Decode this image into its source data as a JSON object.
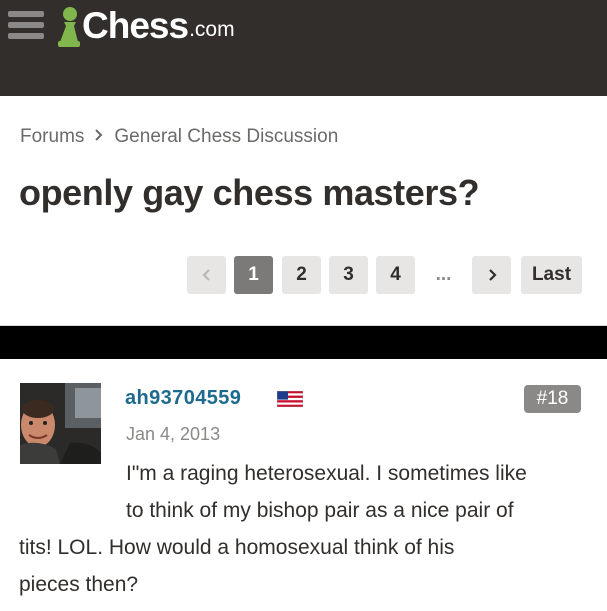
{
  "site": {
    "logo_text": "Chess",
    "logo_suffix": ".com",
    "colors": {
      "topbar": "#312e2b",
      "brand_green": "#81b64c",
      "link_blue": "#1d6a8e"
    }
  },
  "breadcrumb": {
    "items": [
      "Forums",
      "General Chess Discussion"
    ],
    "separator_icon": "chevron-right-icon"
  },
  "thread": {
    "title": "openly gay chess masters?"
  },
  "pagination": {
    "prev_icon": "chevron-left-icon",
    "pages": [
      "1",
      "2",
      "3",
      "4"
    ],
    "current_page": "1",
    "ellipsis": "...",
    "next_icon": "chevron-right-icon",
    "last_label": "Last"
  },
  "post": {
    "username": "ah93704559",
    "country_flag": "us-flag-icon",
    "date": "Jan 4, 2013",
    "number": "#18",
    "body_lines": [
      "I\"m a raging heterosexual. I sometimes like",
      "to think of my bishop pair as a nice pair of",
      "tits! LOL. How would a homosexual think of his",
      "pieces then?"
    ]
  }
}
